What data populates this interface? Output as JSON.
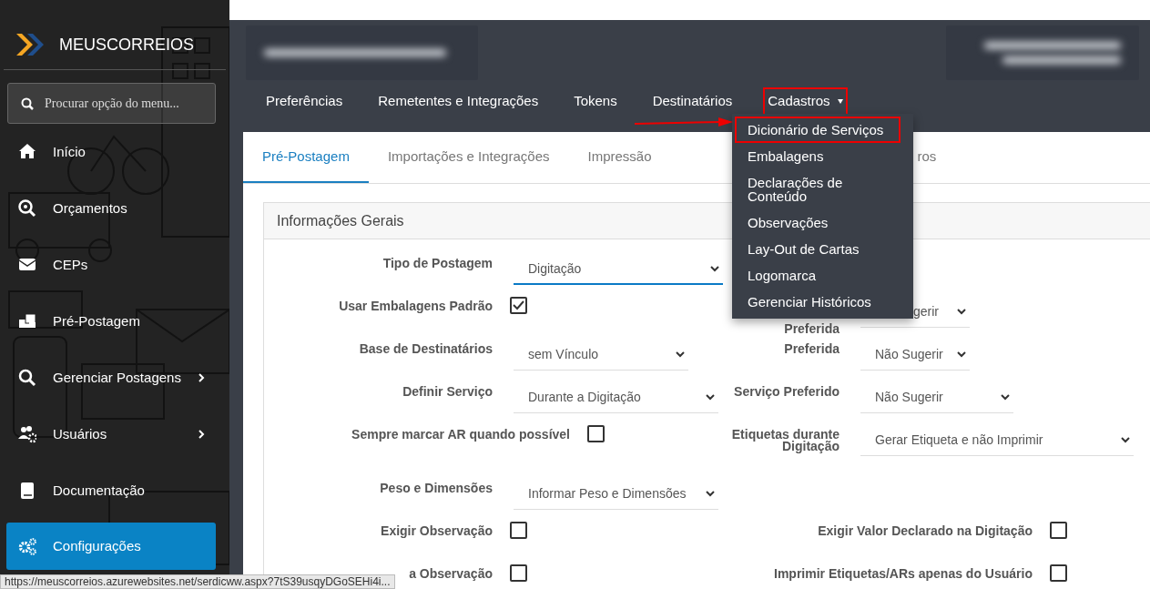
{
  "sidebar": {
    "brand": "MEUSCORREIOS",
    "search": {
      "placeholder": "Procurar opção do menu..."
    },
    "items": [
      {
        "label": "Início",
        "selected": false,
        "expandable": false
      },
      {
        "label": "Orçamentos",
        "selected": false,
        "expandable": false
      },
      {
        "label": "CEPs",
        "selected": false,
        "expandable": false
      },
      {
        "label": "Pré-Postagem",
        "selected": false,
        "expandable": false
      },
      {
        "label": "Gerenciar Postagens",
        "selected": false,
        "expandable": true
      },
      {
        "label": "Usuários",
        "selected": false,
        "expandable": true
      },
      {
        "label": "Documentação",
        "selected": false,
        "expandable": false
      },
      {
        "label": "Configurações",
        "selected": true,
        "expandable": false
      }
    ]
  },
  "header": {
    "nav": [
      {
        "label": "Preferências",
        "highlighted": false,
        "dropdown": false
      },
      {
        "label": "Remetentes e Integrações",
        "highlighted": false,
        "dropdown": false
      },
      {
        "label": "Tokens",
        "highlighted": false,
        "dropdown": false
      },
      {
        "label": "Destinatários",
        "highlighted": false,
        "dropdown": false
      },
      {
        "label": "Cadastros",
        "highlighted": true,
        "dropdown": true
      }
    ]
  },
  "dropdown": {
    "items": [
      {
        "label": "Dicionário de Serviços",
        "highlighted": true
      },
      {
        "label": "Embalagens",
        "highlighted": false
      },
      {
        "label": "Declarações de Conteúdo",
        "highlighted": false
      },
      {
        "label": "Observações",
        "highlighted": false
      },
      {
        "label": "Lay-Out de Cartas",
        "highlighted": false
      },
      {
        "label": "Logomarca",
        "highlighted": false
      },
      {
        "label": "Gerenciar Históricos",
        "highlighted": false
      }
    ]
  },
  "tabs": [
    {
      "label": "Pré-Postagem",
      "selected": true
    },
    {
      "label": "Importações e Integrações",
      "selected": false
    },
    {
      "label": "Impressão",
      "selected": false
    },
    {
      "label": "ros",
      "selected": false
    }
  ],
  "panel": {
    "title": "Informações Gerais",
    "rows": [
      {
        "left": {
          "kind": "select",
          "label": "Tipo de Postagem",
          "value": "Digitação",
          "focused": true
        }
      },
      {
        "left": {
          "kind": "checkbox",
          "label": "Usar Embalagens Padrão",
          "checked": true
        },
        "right": {
          "kind": "select",
          "label": "Preferida",
          "value": "gerir",
          "focused": false
        }
      },
      {
        "left": {
          "kind": "select",
          "label": "Base de Destinatários",
          "value": "sem Vínculo",
          "focused": false
        },
        "right": {
          "kind": "select",
          "label": "Preferida",
          "value": "Não Sugerir",
          "focused": false
        }
      },
      {
        "left": {
          "kind": "select",
          "label": "Definir Serviço",
          "value": "Durante a Digitação",
          "focused": false
        },
        "right": {
          "kind": "select",
          "label": "Serviço Preferido",
          "value": "Não Sugerir",
          "focused": false
        }
      },
      {
        "left": {
          "kind": "checkbox",
          "label": "Sempre marcar AR quando possível",
          "checked": false
        },
        "right": {
          "kind": "select",
          "label": "Etiquetas durante Digitação",
          "value": "Gerar Etiqueta e não Imprimir",
          "focused": false
        }
      },
      {
        "left": {
          "kind": "select",
          "label": "Peso e Dimensões",
          "value": "Informar Peso e Dimensões",
          "focused": false
        }
      },
      {
        "left": {
          "kind": "checkbox",
          "label": "Exigir Observação",
          "checked": false
        },
        "right": {
          "kind": "checkbox",
          "label": "Exigir Valor Declarado na Digitação",
          "checked": false
        }
      },
      {
        "left": {
          "kind": "checkbox",
          "label": "a Observação",
          "checked": false
        },
        "right": {
          "kind": "checkbox",
          "label": "Imprimir Etiquetas/ARs apenas do Usuário",
          "checked": false
        }
      }
    ]
  },
  "status_url": "https://meuscorreios.azurewebsites.net/serdicww.aspx?7tS39usqyDGoSEHi4i..."
}
